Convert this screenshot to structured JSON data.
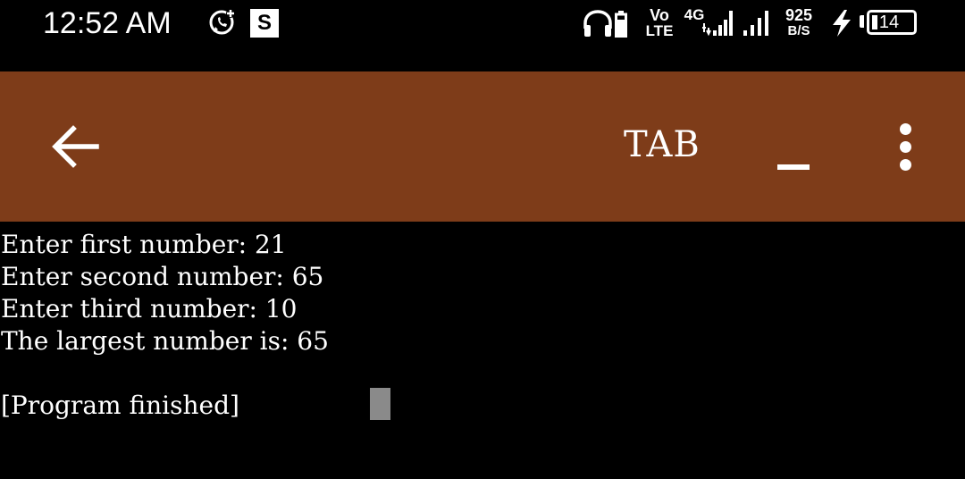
{
  "status_bar": {
    "time": "12:52 AM",
    "notification_icons": [
      "whatsapp-icon",
      "s-badge"
    ],
    "s_badge_label": "S",
    "volte_top": "Vo",
    "volte_bottom": "LTE",
    "network_type": "4G",
    "net_speed_value": "925",
    "net_speed_unit": "B/S",
    "battery_level": "14",
    "battery_fraction": 0.14,
    "charging": true
  },
  "toolbar": {
    "title": "TAB",
    "background_color": "#7e3c19",
    "icons": [
      "arrow-left-icon",
      "minimize-icon",
      "more-vertical-icon"
    ]
  },
  "terminal": {
    "lines": [
      "Enter first number: 21",
      "Enter second number: 65",
      "Enter third number: 10",
      "The largest number is: 65",
      "",
      "[Program finished]"
    ],
    "cursor_color": "#8a8a8a"
  }
}
